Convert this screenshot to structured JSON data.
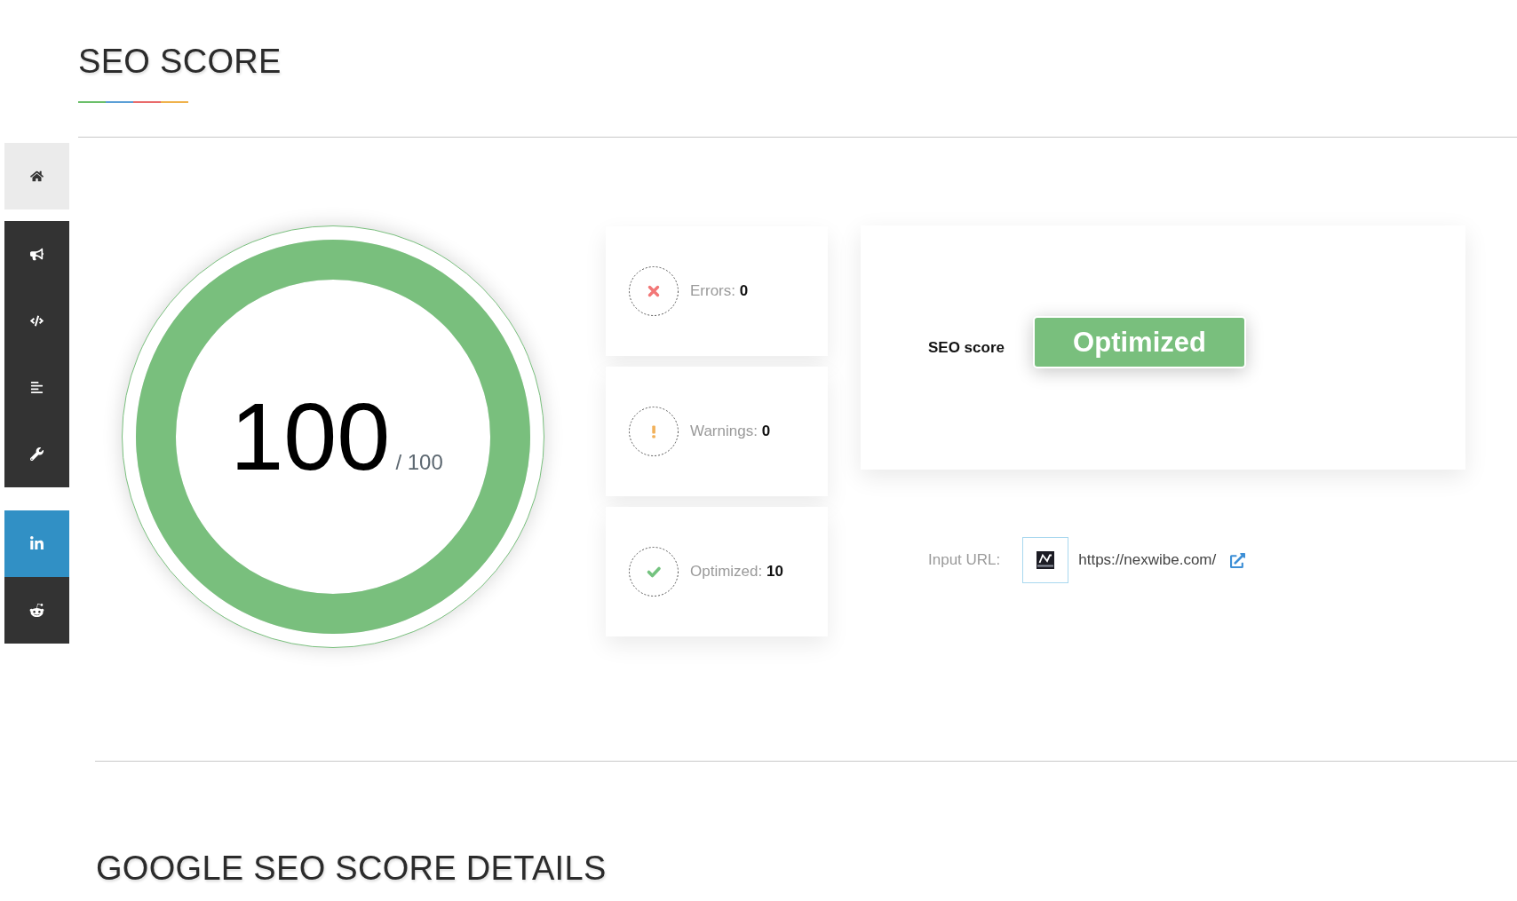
{
  "title": "SEO SCORE",
  "score": {
    "value": "100",
    "max": "/ 100",
    "level": 1
  },
  "stats": [
    {
      "kind": "error",
      "label": "Errors:",
      "value": "0"
    },
    {
      "kind": "warning",
      "label": "Warnings:",
      "value": "0"
    },
    {
      "kind": "success",
      "label": "Optimized:",
      "value": "10"
    }
  ],
  "seo_score": {
    "label": "SEO score",
    "badge": "Optimized"
  },
  "input_url": {
    "label": "Input URL:",
    "url": "https://nexwibe.com/"
  },
  "details_title": "GOOGLE SEO SCORE DETAILS"
}
